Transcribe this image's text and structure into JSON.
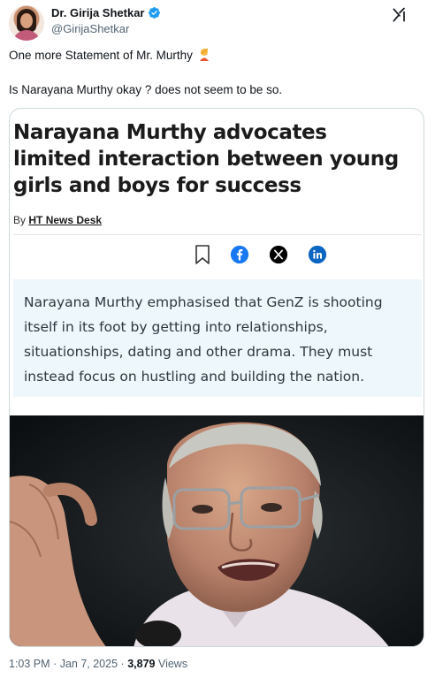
{
  "author": {
    "display_name": "Dr. Girija Shetkar",
    "handle": "@GirijaShetkar",
    "verified": true,
    "verified_color": "#1d9bf0"
  },
  "tweet": {
    "line1": "One more Statement of Mr. Murthy",
    "line1_emoji": "person-facepalming-emoji",
    "line2": "Is Narayana Murthy okay ? does not seem to be so."
  },
  "article_card": {
    "headline": "Narayana Murthy advocates limited interaction between young girls and boys for success",
    "byline_prefix": "By",
    "byline_author": "HT News Desk",
    "share_icons": [
      "bookmark-icon",
      "facebook-icon",
      "x-icon",
      "linkedin-icon"
    ],
    "summary": "Narayana Murthy emphasised that GenZ is shooting itself in its foot by getting into relationships, situationships, dating and other drama. They must instead focus on hustling and building the nation.",
    "summary_bg": "#eef7fb",
    "image": "photo-of-elderly-man-with-glasses-speaking"
  },
  "meta": {
    "time": "1:03 PM",
    "separator": "·",
    "date": "Jan 7, 2025",
    "views_count": "3,879",
    "views_label": "Views"
  },
  "colors": {
    "text_primary": "#0f1419",
    "text_secondary": "#536471",
    "facebook": "#1877f2",
    "linkedin": "#0a66c2",
    "card_border": "#cfd9de"
  }
}
